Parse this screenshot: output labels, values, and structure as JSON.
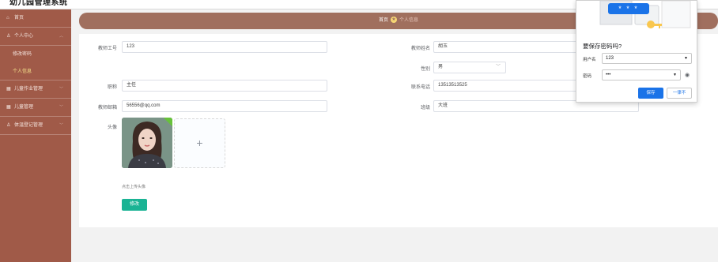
{
  "app": {
    "title": "幼儿园管理系统"
  },
  "sidebar": {
    "home": "首页",
    "personal_center": "个人中心",
    "change_password": "修改密码",
    "personal_info": "个人信息",
    "children_work": "儿童作业管理",
    "children_manage": "儿童管理",
    "health_register": "体温登记管理"
  },
  "breadcrumb": {
    "home": "首页",
    "current": "个人信息"
  },
  "form": {
    "teacher_id_label": "教师工号",
    "teacher_id_value": "123",
    "teacher_name_label": "教师姓名",
    "teacher_name_value": "胡玉",
    "gender_label": "性别",
    "gender_value": "男",
    "title_label": "职称",
    "title_value": "主任",
    "phone_label": "联系电话",
    "phone_value": "13513513525",
    "email_label": "教师邮箱",
    "email_value": "56556@qq.com",
    "class_label": "班级",
    "class_value": "大班",
    "avatar_label": "头像",
    "upload_tip": "点击上传头像",
    "upload_plus": "+",
    "submit_label": "修改"
  },
  "password_popup": {
    "masked_preview": "* * *",
    "title": "要保存密码吗?",
    "username_label": "用户名",
    "username_value": "123",
    "password_label": "密码",
    "password_value": "•••",
    "save_label": "保存",
    "never_label": "一律不"
  },
  "colors": {
    "sidebar_bg": "#a05a48",
    "breadcrumb_bg": "#a06f5e",
    "submit_button": "#1ab394",
    "chrome_blue": "#1a73e8"
  }
}
